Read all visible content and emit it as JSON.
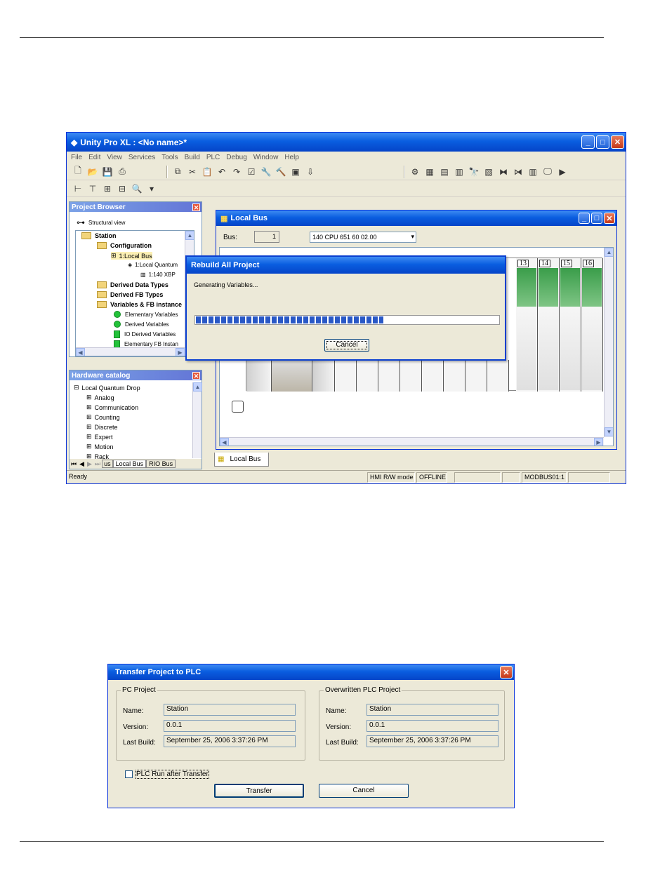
{
  "main_window": {
    "title": "Unity Pro XL : <No name>*",
    "menu": [
      "File",
      "Edit",
      "View",
      "Services",
      "Tools",
      "Build",
      "PLC",
      "Debug",
      "Window",
      "Help"
    ],
    "status": {
      "ready": "Ready",
      "hmi": "HMI R/W mode",
      "offline": "OFFLINE",
      "modbus": "MODBUS01:1"
    }
  },
  "project_browser": {
    "title": "Project Browser",
    "view": "Structural view",
    "items": [
      "Station",
      "Configuration",
      "1:Local Bus",
      "1:Local Quantum",
      "1:140 XBP",
      "Derived Data Types",
      "Derived FB Types",
      "Variables & FB instance",
      "Elementary Variables",
      "Derived Variables",
      "IO Derived Variables",
      "Elementary FB Instan"
    ]
  },
  "hardware_catalog": {
    "title": "Hardware catalog",
    "root": "Local Quantum Drop",
    "items": [
      "Analog",
      "Communication",
      "Counting",
      "Discrete",
      "Expert",
      "Motion",
      "Rack"
    ],
    "tabs": [
      "us",
      "Local Bus",
      "RIO Bus"
    ]
  },
  "local_bus": {
    "title": "Local Bus",
    "bus_label": "Bus:",
    "bus_value": "1",
    "cpu": "140 CPU 651 60   02.00",
    "slot_numbers": [
      "13",
      "14",
      "15",
      "16"
    ],
    "tab": "Local Bus"
  },
  "rebuild": {
    "title": "Rebuild All Project",
    "message": "Generating Variables...",
    "progress": 0.62,
    "cancel": "Cancel"
  },
  "transfer": {
    "title": "Transfer Project to PLC",
    "pc_group": "PC Project",
    "plc_group": "Overwritten PLC Project",
    "labels": {
      "name": "Name:",
      "version": "Version:",
      "last_build": "Last Build:"
    },
    "pc": {
      "name": "Station",
      "version": "0.0.1",
      "last_build": "September 25, 2006 3:37:26 PM"
    },
    "plc": {
      "name": "Station",
      "version": "0.0.1",
      "last_build": "September 25, 2006 3:37:26 PM"
    },
    "checkbox": "PLC Run after Transfer",
    "transfer_btn": "Transfer",
    "cancel_btn": "Cancel"
  },
  "colors": {
    "xp_blue": "#0a5ee0",
    "progress": "#2958c6",
    "module_green": "#3a9d4a"
  }
}
